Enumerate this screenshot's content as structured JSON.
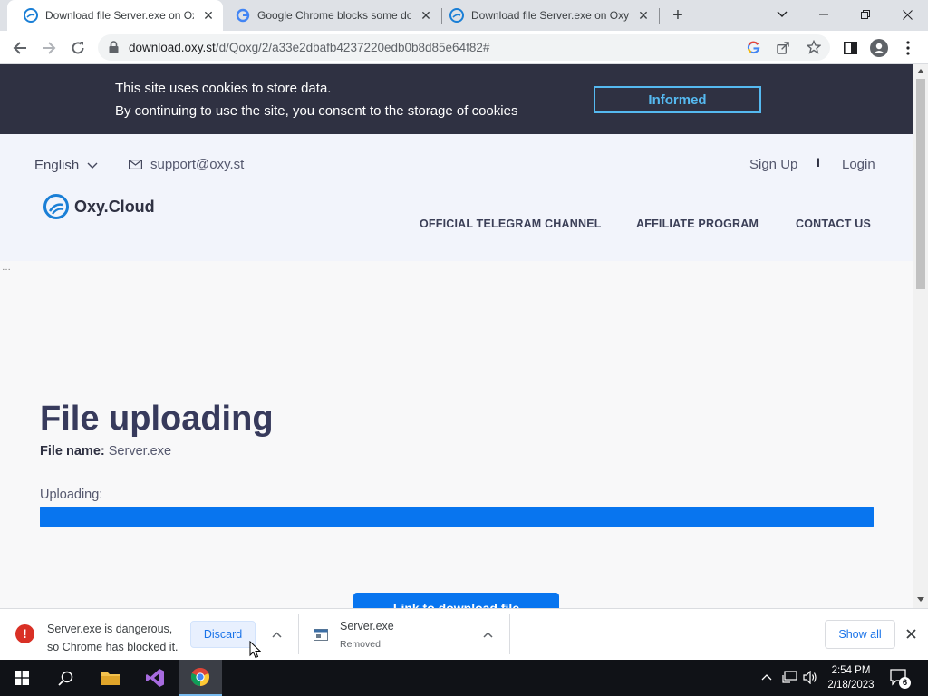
{
  "browser": {
    "tabs": [
      {
        "title": "Download file Server.exe on Oxy",
        "active": true
      },
      {
        "title": "Google Chrome blocks some dow",
        "active": false
      },
      {
        "title": "Download file Server.exe on Oxy",
        "active": false
      }
    ],
    "url_host": "download.oxy.st",
    "url_path": "/d/Qoxg/2/a33e2dbafb4237220edb0b8d85e64f82#"
  },
  "cookie_banner": {
    "line1": "This site uses cookies to store data.",
    "line2": "By continuing to use the site, you consent to the storage of cookies",
    "button": "Informed"
  },
  "header": {
    "language": "English",
    "email": "support@oxy.st",
    "sign_up": "Sign Up",
    "separator": "I",
    "login": "Login",
    "brand": "Oxy.Cloud",
    "nav": [
      "OFFICIAL TELEGRAM CHANNEL",
      "AFFILIATE PROGRAM",
      "CONTACT US"
    ]
  },
  "main": {
    "title": "File uploading",
    "file_name_label": "File name:",
    "file_name": "Server.exe",
    "uploading_label": "Uploading:",
    "progress": 1.0,
    "download_button": "Link to download file"
  },
  "download_shelf": {
    "item1": {
      "line1": "Server.exe is dangerous,",
      "line2": "so Chrome has blocked it.",
      "action": "Discard"
    },
    "item2": {
      "name": "Server.exe",
      "status": "Removed"
    },
    "show_all": "Show all"
  },
  "taskbar": {
    "time": "2:54 PM",
    "date": "2/18/2023",
    "notifications": "6"
  },
  "colors": {
    "accent": "#0875ef",
    "banner": "#2f3142",
    "informed": "#55b9f0",
    "danger": "#d93025"
  }
}
